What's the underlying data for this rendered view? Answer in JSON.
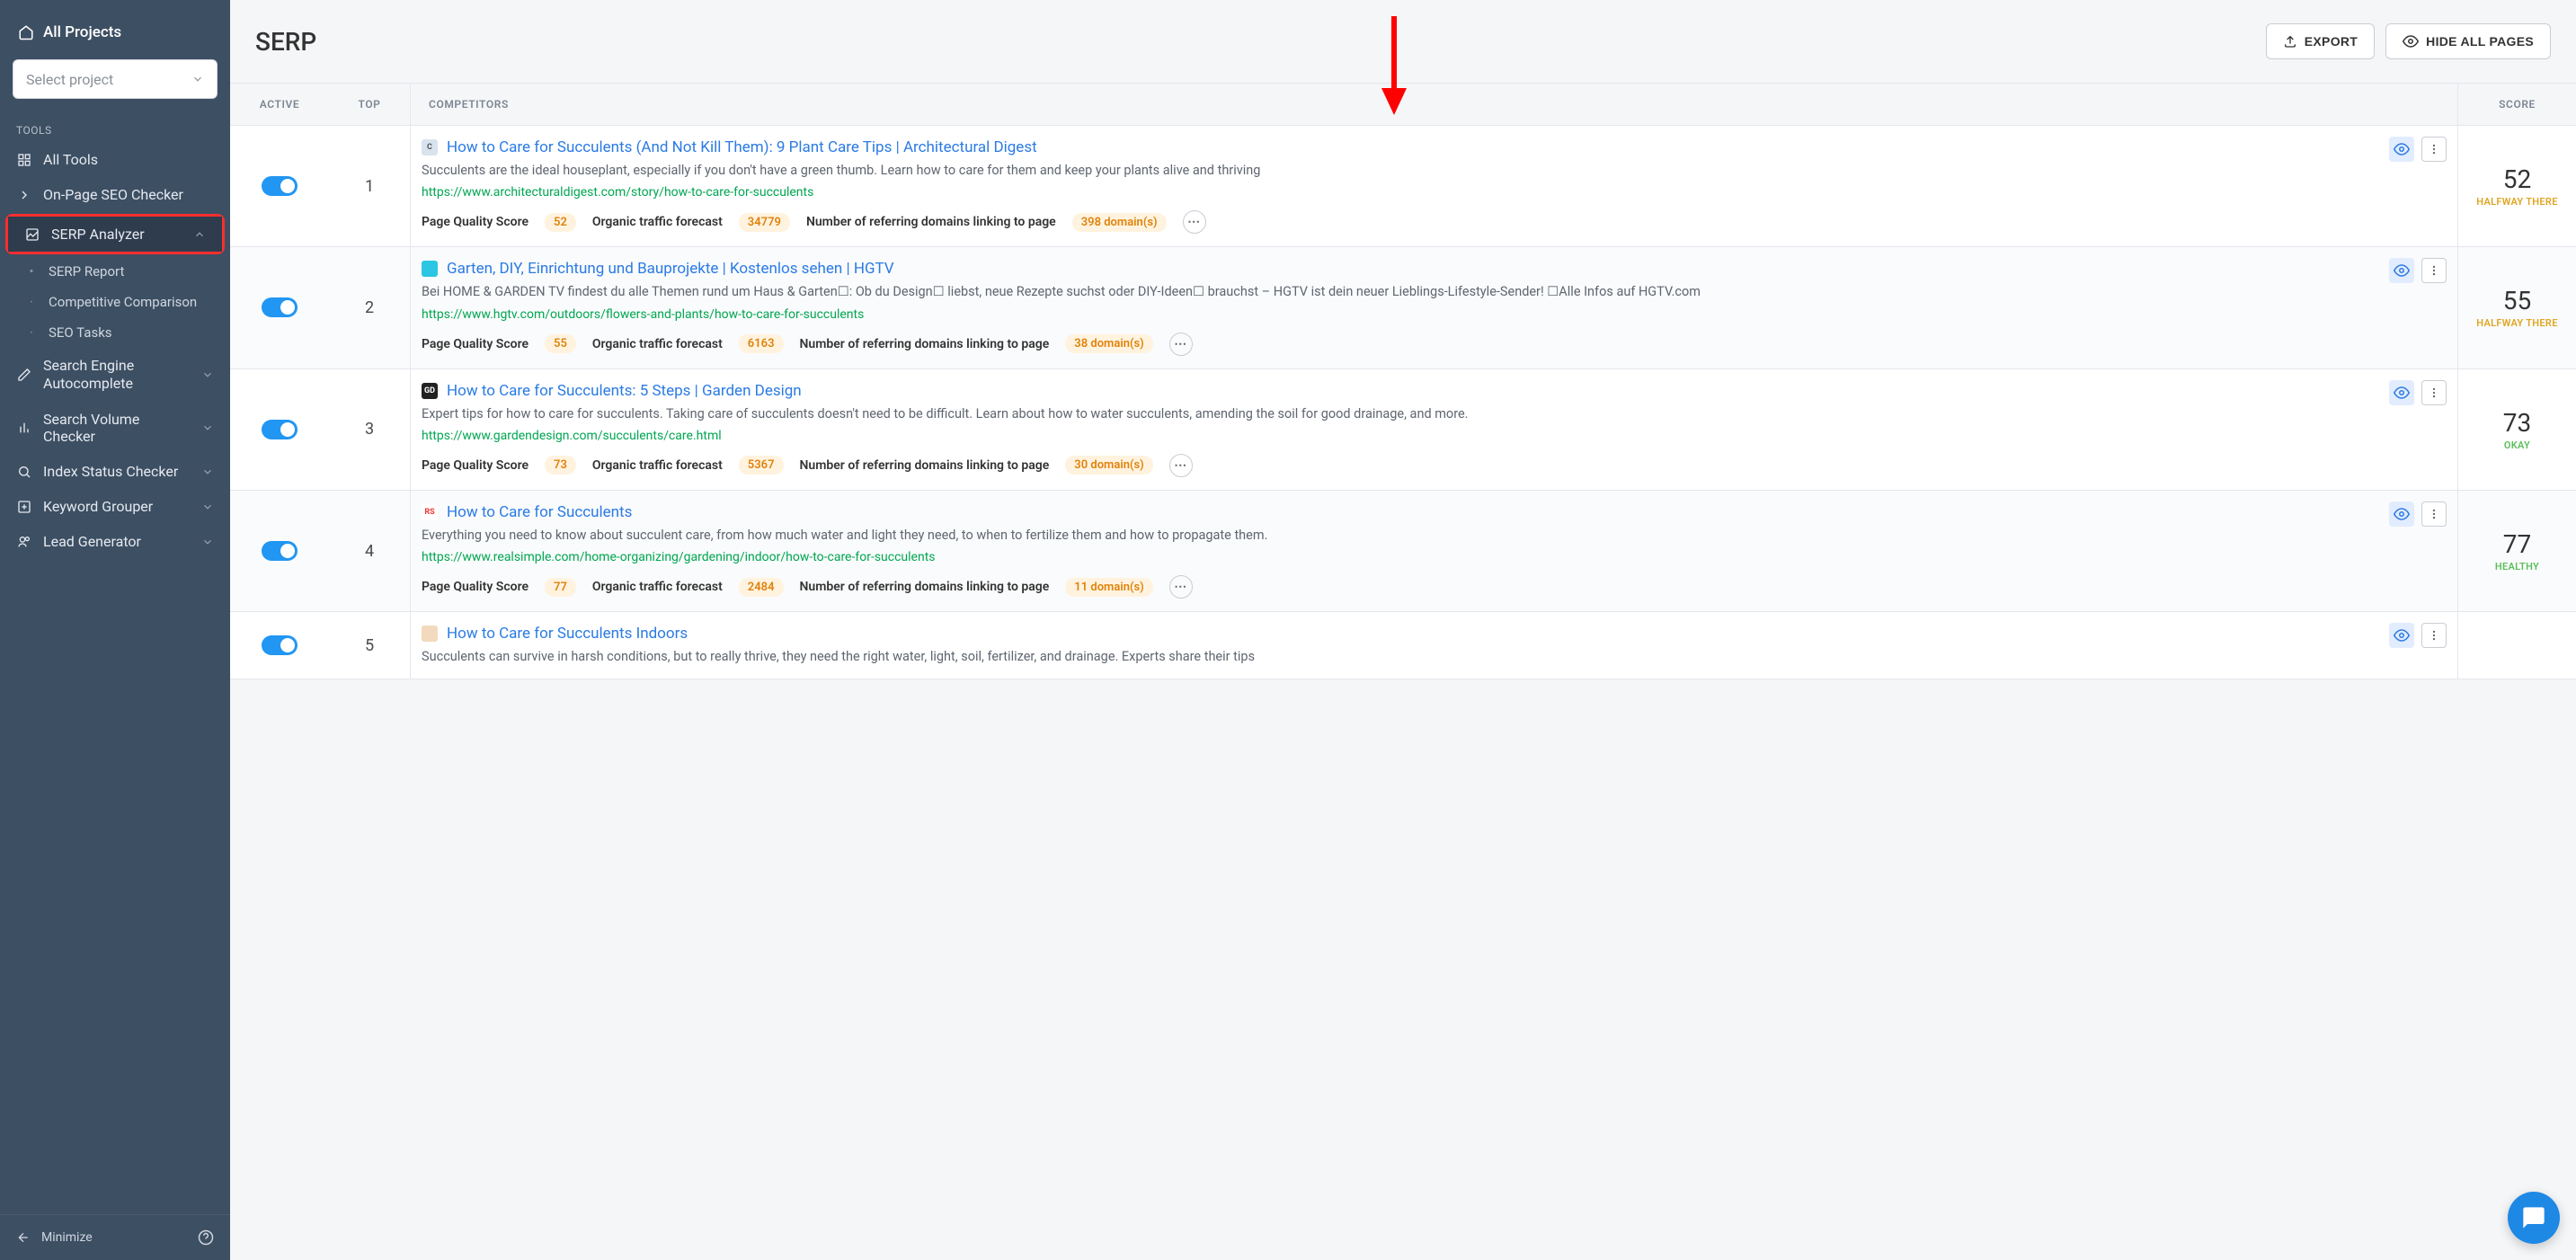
{
  "sidebar": {
    "all_projects": "All Projects",
    "select_project_placeholder": "Select project",
    "tools_label": "TOOLS",
    "items": {
      "all_tools": "All Tools",
      "onpage": "On-Page SEO Checker",
      "serp_analyzer": "SERP Analyzer",
      "serp_report": "SERP Report",
      "competitive": "Competitive Comparison",
      "seo_tasks": "SEO Tasks",
      "autocomplete": "Search Engine Autocomplete",
      "volume": "Search Volume Checker",
      "index": "Index Status Checker",
      "keyword_grouper": "Keyword Grouper",
      "lead_generator": "Lead Generator"
    },
    "minimize": "Minimize"
  },
  "header": {
    "title": "SERP",
    "export": "EXPORT",
    "hide_all": "HIDE ALL PAGES"
  },
  "columns": {
    "active": "ACTIVE",
    "top": "TOP",
    "competitors": "COMPETITORS",
    "score": "SCORE"
  },
  "metric_labels": {
    "pqs": "Page Quality Score",
    "traffic": "Organic traffic forecast",
    "referring": "Number of referring domains linking to page"
  },
  "results": [
    {
      "rank": "1",
      "favicon_bg": "#d9e3ef",
      "favicon_text": "C",
      "title": "How to Care for Succulents (And Not Kill Them): 9 Plant Care Tips | Architectural Digest",
      "desc": "Succulents are the ideal houseplant, especially if you don't have a green thumb. Learn how to care for them and keep your plants alive and thriving",
      "url": "https://www.architecturaldigest.com/story/how-to-care-for-succulents",
      "pqs": "52",
      "traffic": "34779",
      "domains": "398 domain(s)",
      "score": "52",
      "score_label": "HALFWAY THERE",
      "score_class": "score-halfway"
    },
    {
      "rank": "2",
      "favicon_bg": "#2bc6e4",
      "favicon_text": " ",
      "title": "Garten, DIY, Einrichtung und Bauprojekte | Kostenlos sehen | HGTV",
      "desc": "Bei HOME & GARDEN TV findest du alle Themen rund um Haus & Garten☐: Ob du Design☐ liebst, neue Rezepte suchst oder DIY-Ideen☐ brauchst – HGTV ist dein neuer Lieblings-Lifestyle-Sender! ☐Alle Infos auf HGTV.com",
      "url": "https://www.hgtv.com/outdoors/flowers-and-plants/how-to-care-for-succulents",
      "pqs": "55",
      "traffic": "6163",
      "domains": "38 domain(s)",
      "score": "55",
      "score_label": "HALFWAY THERE",
      "score_class": "score-halfway"
    },
    {
      "rank": "3",
      "favicon_bg": "#222",
      "favicon_text": "GD",
      "favicon_color": "#fff",
      "title": "How to Care for Succulents: 5 Steps | Garden Design",
      "desc": "Expert tips for how to care for succulents. Taking care of succulents doesn't need to be difficult. Learn about how to water succulents, amending the soil for good drainage, and more.",
      "url": "https://www.gardendesign.com/succulents/care.html",
      "pqs": "73",
      "traffic": "5367",
      "domains": "30 domain(s)",
      "score": "73",
      "score_label": "OKAY",
      "score_class": "score-okay"
    },
    {
      "rank": "4",
      "favicon_bg": "#fff",
      "favicon_text": "RS",
      "favicon_color": "#e33",
      "title": "How to Care for Succulents",
      "desc": "Everything you need to know about succulent care, from how much water and light they need, to when to fertilize them and how to propagate them.",
      "url": "https://www.realsimple.com/home-organizing/gardening/indoor/how-to-care-for-succulents",
      "pqs": "77",
      "traffic": "2484",
      "domains": "11 domain(s)",
      "score": "77",
      "score_label": "HEALTHY",
      "score_class": "score-healthy"
    },
    {
      "rank": "5",
      "favicon_bg": "#f3d9bd",
      "favicon_text": " ",
      "title": "How to Care for Succulents Indoors",
      "desc": "Succulents can survive in harsh conditions, but to really thrive, they need the right water, light, soil, fertilizer, and drainage. Experts share their tips",
      "url": "",
      "pqs": "",
      "traffic": "",
      "domains": "",
      "score": "",
      "score_label": "",
      "score_class": ""
    }
  ]
}
